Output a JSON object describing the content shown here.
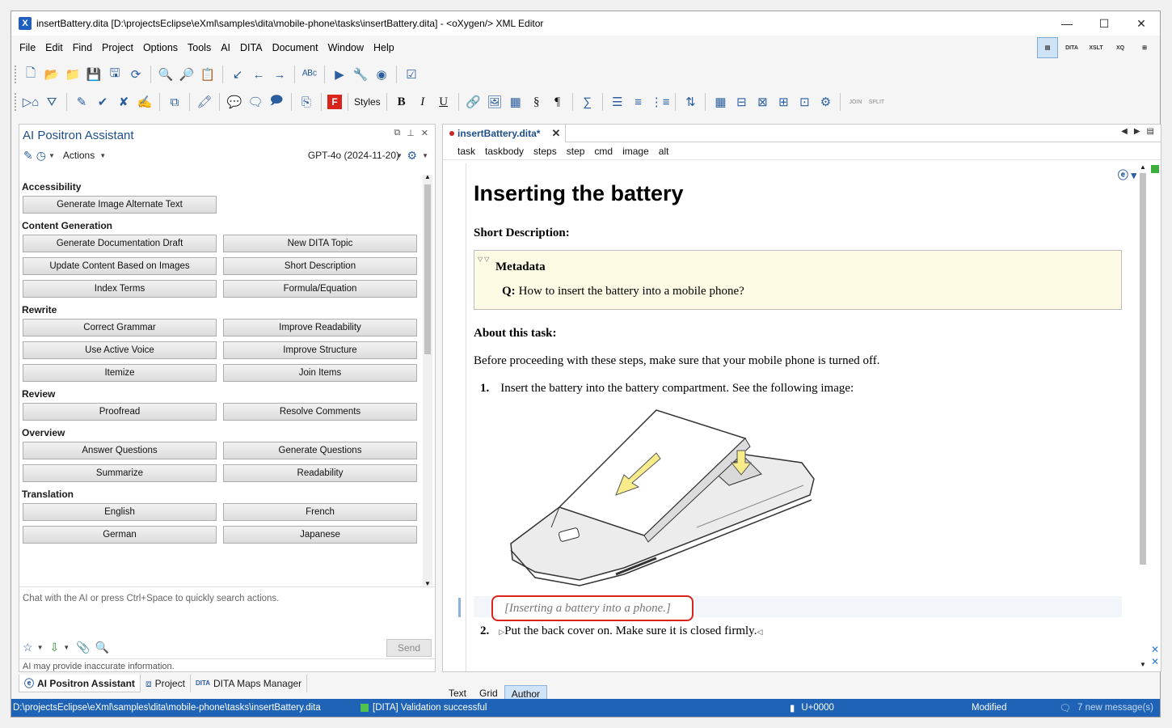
{
  "window": {
    "title": "insertBattery.dita [D:\\projectsEclipse\\eXml\\samples\\dita\\mobile-phone\\tasks\\insertBattery.dita] - <oXygen/> XML Editor",
    "minimize": "—",
    "maximize": "☐",
    "close": "✕",
    "app_icon": "X"
  },
  "menu": [
    "File",
    "Edit",
    "Find",
    "Project",
    "Options",
    "Tools",
    "AI",
    "DITA",
    "Document",
    "Window",
    "Help"
  ],
  "perspectives": [
    {
      "name": "editor-perspective-icon",
      "label": "▤"
    },
    {
      "name": "dita-perspective-icon",
      "label": "DITA"
    },
    {
      "name": "xslt-perspective-icon",
      "label": "XSLT"
    },
    {
      "name": "xquery-perspective-icon",
      "label": "XQ"
    },
    {
      "name": "database-perspective-icon",
      "label": "⊞"
    }
  ],
  "toolbar1": [
    {
      "name": "new-file-icon",
      "glyph": "🗋"
    },
    {
      "name": "open-icon",
      "glyph": "📂"
    },
    {
      "name": "open-url-icon",
      "glyph": "📁"
    },
    {
      "name": "save-icon",
      "glyph": "💾"
    },
    {
      "name": "save-all-icon",
      "glyph": "🖫"
    },
    {
      "name": "reload-icon",
      "glyph": "⟳"
    },
    {
      "sep": true
    },
    {
      "name": "find-icon",
      "glyph": "🔍"
    },
    {
      "name": "find-in-files-icon",
      "glyph": "🔎"
    },
    {
      "name": "paste-icon",
      "glyph": "📋"
    },
    {
      "sep": true
    },
    {
      "name": "go-to-last-modification-icon",
      "glyph": "↙"
    },
    {
      "name": "back-icon",
      "glyph": "←"
    },
    {
      "name": "forward-icon",
      "glyph": "→"
    },
    {
      "sep": true
    },
    {
      "name": "spell-check-icon",
      "glyph": "ᴬᴮᶜ"
    },
    {
      "sep": true
    },
    {
      "name": "run-transformation-icon",
      "glyph": "▶"
    },
    {
      "name": "configure-transformation-icon",
      "glyph": "🔧"
    },
    {
      "name": "debug-icon",
      "glyph": "◉"
    },
    {
      "sep": true
    },
    {
      "name": "validate-icon",
      "glyph": "☑"
    }
  ],
  "toolbar2": [
    {
      "name": "tag-display-icon",
      "glyph": "▷⌂"
    },
    {
      "name": "filter-icon",
      "glyph": "⛛"
    },
    {
      "sep": true
    },
    {
      "name": "edit-review-icon",
      "glyph": "✎"
    },
    {
      "name": "accept-change-icon",
      "glyph": "✔"
    },
    {
      "name": "reject-change-icon",
      "glyph": "✘"
    },
    {
      "name": "comment-icon",
      "glyph": "✍"
    },
    {
      "sep": true
    },
    {
      "name": "manage-reviews-icon",
      "glyph": "⧉"
    },
    {
      "sep": true
    },
    {
      "name": "highlight-icon",
      "glyph": "🖍"
    },
    {
      "sep": true
    },
    {
      "name": "add-comment-icon",
      "glyph": "💬"
    },
    {
      "name": "edit-comment-icon",
      "glyph": "🗨"
    },
    {
      "name": "remove-comment-icon",
      "glyph": "🗩"
    },
    {
      "sep": true
    },
    {
      "name": "review-panel-icon",
      "glyph": "⎘"
    },
    {
      "sep": true
    },
    {
      "name": "fonts-icon",
      "glyph": "F"
    },
    {
      "sep": true
    },
    {
      "name": "styles-dropdown",
      "glyph": "Styles"
    },
    {
      "sep": true
    },
    {
      "name": "bold-icon",
      "glyph": "B"
    },
    {
      "name": "italic-icon",
      "glyph": "I"
    },
    {
      "name": "underline-icon",
      "glyph": "U"
    },
    {
      "sep": true
    },
    {
      "name": "link-icon",
      "glyph": "🔗"
    },
    {
      "name": "image-icon",
      "glyph": "🖼"
    },
    {
      "name": "media-icon",
      "glyph": "▦"
    },
    {
      "name": "section-icon",
      "glyph": "§"
    },
    {
      "name": "paragraph-icon",
      "glyph": "¶"
    },
    {
      "sep": true
    },
    {
      "name": "equation-icon",
      "glyph": "∑"
    },
    {
      "sep": true
    },
    {
      "name": "step-list-icon",
      "glyph": "☰"
    },
    {
      "name": "ordered-list-icon",
      "glyph": "≡"
    },
    {
      "name": "unordered-list-icon",
      "glyph": "⋮≡"
    },
    {
      "sep": true
    },
    {
      "name": "sort-icon",
      "glyph": "⇅"
    },
    {
      "sep": true
    },
    {
      "name": "table-icon",
      "glyph": "▦"
    },
    {
      "name": "insert-row-icon",
      "glyph": "⊟"
    },
    {
      "name": "delete-row-icon",
      "glyph": "⊠"
    },
    {
      "name": "insert-column-icon",
      "glyph": "⊞"
    },
    {
      "name": "delete-column-icon",
      "glyph": "⊡"
    },
    {
      "name": "table-properties-icon",
      "glyph": "⚙"
    },
    {
      "sep": true
    },
    {
      "name": "join-cells-icon",
      "glyph": "JOIN"
    },
    {
      "name": "split-cell-icon",
      "glyph": "SPLIT"
    }
  ],
  "ai_panel": {
    "title": "AI Positron Assistant",
    "actions_label": "Actions",
    "model": "GPT-4o (2024-11-20)",
    "sections": [
      {
        "title": "Accessibility",
        "buttons": [
          "Generate Image Alternate Text"
        ]
      },
      {
        "title": "Content Generation",
        "buttons": [
          "Generate Documentation Draft",
          "New DITA Topic",
          "Update Content Based on Images",
          "Short Description",
          "Index Terms",
          "Formula/Equation"
        ]
      },
      {
        "title": "Rewrite",
        "buttons": [
          "Correct Grammar",
          "Improve Readability",
          "Use Active Voice",
          "Improve Structure",
          "Itemize",
          "Join Items"
        ]
      },
      {
        "title": "Review",
        "buttons": [
          "Proofread",
          "Resolve Comments"
        ]
      },
      {
        "title": "Overview",
        "buttons": [
          "Answer Questions",
          "Generate Questions",
          "Summarize",
          "Readability"
        ]
      },
      {
        "title": "Translation",
        "buttons": [
          "English",
          "French",
          "German",
          "Japanese"
        ]
      }
    ],
    "chat_placeholder": "Chat with the AI or press Ctrl+Space to quickly search actions.",
    "send_label": "Send",
    "disclaimer": "AI may provide inaccurate information."
  },
  "left_tabs": [
    "AI Positron Assistant",
    "Project",
    "DITA Maps Manager"
  ],
  "editor": {
    "tab_label": "insertBattery.dita*",
    "breadcrumb": [
      "task",
      "taskbody",
      "steps",
      "step",
      "cmd",
      "image",
      "alt"
    ],
    "title": "Inserting the battery",
    "short_desc_label": "Short Description:",
    "metadata_label": "Metadata",
    "q_label": "Q:",
    "q_text": "How to insert the battery into a mobile phone?",
    "about_label": "About this task:",
    "before_text": "Before proceeding with these steps, make sure that your mobile phone is turned off.",
    "step1_num": "1.",
    "step1_text": "Insert the battery into the battery compartment. See the following image:",
    "alt_text": "[Inserting a battery into a phone.]",
    "step2_num": "2.",
    "step2_text": "Put the back cover on. Make sure it is closed firmly.",
    "modes": [
      "Text",
      "Grid",
      "Author"
    ],
    "active_mode": "Author"
  },
  "status": {
    "path": "D:\\projectsEclipse\\eXml\\samples\\dita\\mobile-phone\\tasks\\insertBattery.dita",
    "validation": "[DITA] Validation successful",
    "encoding": "U+0000",
    "modified": "Modified",
    "messages": "7 new message(s)"
  }
}
